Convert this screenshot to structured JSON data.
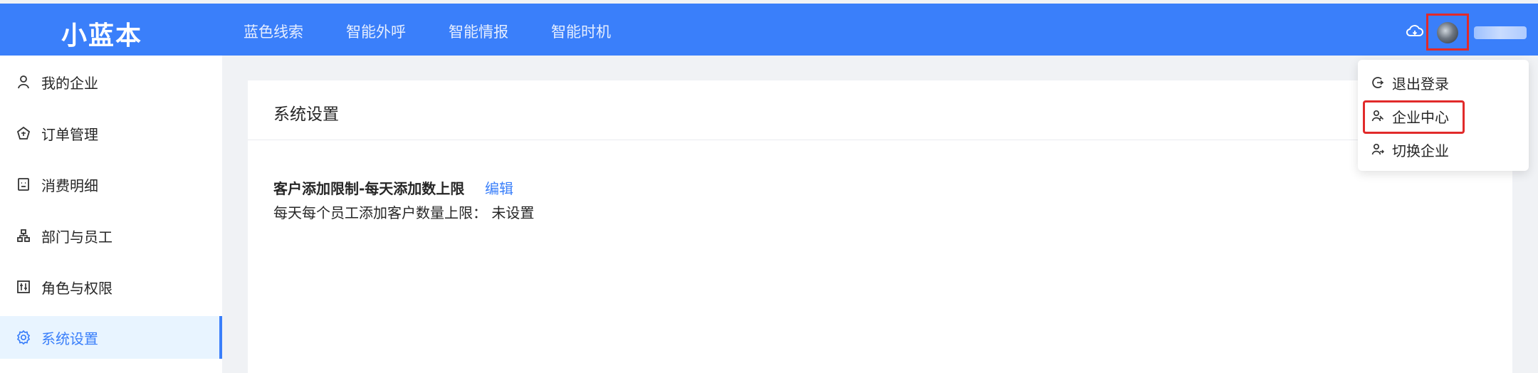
{
  "header": {
    "logo": "小蓝本",
    "nav": [
      "蓝色线索",
      "智能外呼",
      "智能情报",
      "智能时机"
    ],
    "icons": [
      "cloud-icon",
      "avatar-icon"
    ]
  },
  "sidebar": {
    "items": [
      {
        "label": "我的企业",
        "icon": "user-icon"
      },
      {
        "label": "订单管理",
        "icon": "order-icon"
      },
      {
        "label": "消费明细",
        "icon": "bill-icon"
      },
      {
        "label": "部门与员工",
        "icon": "org-icon"
      },
      {
        "label": "角色与权限",
        "icon": "permission-icon"
      },
      {
        "label": "系统设置",
        "icon": "gear-icon"
      }
    ],
    "active": "系统设置"
  },
  "main": {
    "title": "系统设置",
    "limit_title": "客户添加限制-每天添加数上限",
    "edit_label": "编辑",
    "limit_desc": "每天每个员工添加客户数量上限： 未设置"
  },
  "dropdown": {
    "items": [
      {
        "label": "退出登录",
        "icon": "logout-icon"
      },
      {
        "label": "企业中心",
        "icon": "enterprise-icon"
      },
      {
        "label": "切换企业",
        "icon": "switch-icon"
      }
    ]
  },
  "colors": {
    "primary": "#3a7ffa",
    "highlight": "#e12a2a",
    "active_bg": "#e8f4ff"
  }
}
